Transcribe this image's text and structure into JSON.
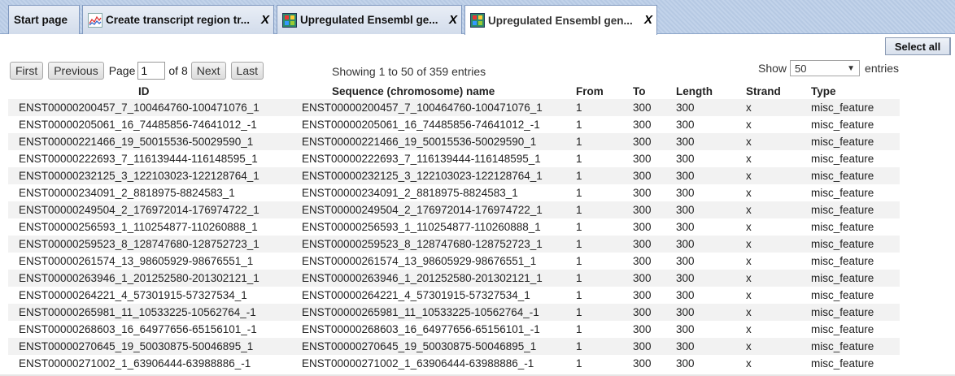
{
  "tabs": [
    {
      "label": "Start page",
      "icon": "none",
      "close": ""
    },
    {
      "label": "Create transcript region tr...",
      "icon": "chart-icon",
      "close": "X"
    },
    {
      "label": "Upregulated Ensembl ge...",
      "icon": "table-icon",
      "close": "X"
    },
    {
      "label": "Upregulated Ensembl gen...",
      "icon": "table-icon",
      "close": "X"
    }
  ],
  "toolbar": {
    "select_all": "Select all"
  },
  "pager": {
    "first": "First",
    "previous": "Previous",
    "page_label": "Page",
    "page_value": "1",
    "of_label": "of 8",
    "next": "Next",
    "last": "Last",
    "showing": "Showing 1 to 50 of 359 entries",
    "show_label": "Show",
    "show_value": "50",
    "entries_label": "entries"
  },
  "table": {
    "columns": [
      "ID",
      "Sequence (chromosome) name",
      "From",
      "To",
      "Length",
      "Strand",
      "Type"
    ],
    "rows": [
      [
        "ENST00000200457_7_100464760-100471076_1",
        "ENST00000200457_7_100464760-100471076_1",
        "1",
        "300",
        "300",
        "x",
        "misc_feature"
      ],
      [
        "ENST00000205061_16_74485856-74641012_-1",
        "ENST00000205061_16_74485856-74641012_-1",
        "1",
        "300",
        "300",
        "x",
        "misc_feature"
      ],
      [
        "ENST00000221466_19_50015536-50029590_1",
        "ENST00000221466_19_50015536-50029590_1",
        "1",
        "300",
        "300",
        "x",
        "misc_feature"
      ],
      [
        "ENST00000222693_7_116139444-116148595_1",
        "ENST00000222693_7_116139444-116148595_1",
        "1",
        "300",
        "300",
        "x",
        "misc_feature"
      ],
      [
        "ENST00000232125_3_122103023-122128764_1",
        "ENST00000232125_3_122103023-122128764_1",
        "1",
        "300",
        "300",
        "x",
        "misc_feature"
      ],
      [
        "ENST00000234091_2_8818975-8824583_1",
        "ENST00000234091_2_8818975-8824583_1",
        "1",
        "300",
        "300",
        "x",
        "misc_feature"
      ],
      [
        "ENST00000249504_2_176972014-176974722_1",
        "ENST00000249504_2_176972014-176974722_1",
        "1",
        "300",
        "300",
        "x",
        "misc_feature"
      ],
      [
        "ENST00000256593_1_110254877-110260888_1",
        "ENST00000256593_1_110254877-110260888_1",
        "1",
        "300",
        "300",
        "x",
        "misc_feature"
      ],
      [
        "ENST00000259523_8_128747680-128752723_1",
        "ENST00000259523_8_128747680-128752723_1",
        "1",
        "300",
        "300",
        "x",
        "misc_feature"
      ],
      [
        "ENST00000261574_13_98605929-98676551_1",
        "ENST00000261574_13_98605929-98676551_1",
        "1",
        "300",
        "300",
        "x",
        "misc_feature"
      ],
      [
        "ENST00000263946_1_201252580-201302121_1",
        "ENST00000263946_1_201252580-201302121_1",
        "1",
        "300",
        "300",
        "x",
        "misc_feature"
      ],
      [
        "ENST00000264221_4_57301915-57327534_1",
        "ENST00000264221_4_57301915-57327534_1",
        "1",
        "300",
        "300",
        "x",
        "misc_feature"
      ],
      [
        "ENST00000265981_11_10533225-10562764_-1",
        "ENST00000265981_11_10533225-10562764_-1",
        "1",
        "300",
        "300",
        "x",
        "misc_feature"
      ],
      [
        "ENST00000268603_16_64977656-65156101_-1",
        "ENST00000268603_16_64977656-65156101_-1",
        "1",
        "300",
        "300",
        "x",
        "misc_feature"
      ],
      [
        "ENST00000270645_19_50030875-50046895_1",
        "ENST00000270645_19_50030875-50046895_1",
        "1",
        "300",
        "300",
        "x",
        "misc_feature"
      ],
      [
        "ENST00000271002_1_63906444-63988886_-1",
        "ENST00000271002_1_63906444-63988886_-1",
        "1",
        "300",
        "300",
        "x",
        "misc_feature"
      ]
    ]
  }
}
